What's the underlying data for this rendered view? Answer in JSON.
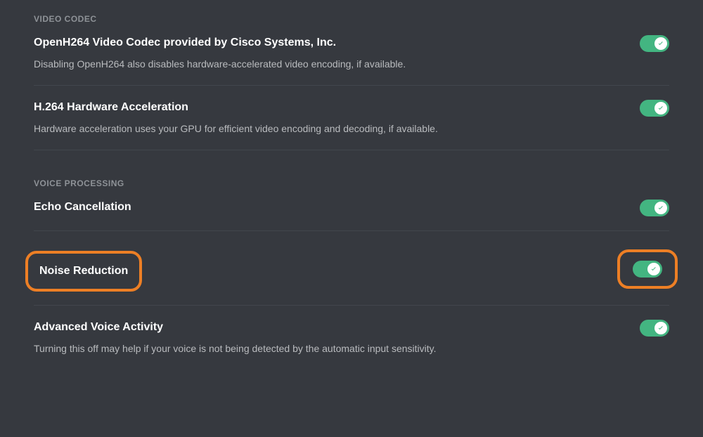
{
  "sections": {
    "videoCodec": {
      "header": "VIDEO CODEC",
      "items": [
        {
          "title": "OpenH264 Video Codec provided by Cisco Systems, Inc.",
          "desc": "Disabling OpenH264 also disables hardware-accelerated video encoding, if available.",
          "enabled": true
        },
        {
          "title": "H.264 Hardware Acceleration",
          "desc": "Hardware acceleration uses your GPU for efficient video encoding and decoding, if available.",
          "enabled": true
        }
      ]
    },
    "voiceProcessing": {
      "header": "VOICE PROCESSING",
      "items": [
        {
          "title": "Echo Cancellation",
          "enabled": true
        },
        {
          "title": "Noise Reduction",
          "enabled": true,
          "highlighted": true
        },
        {
          "title": "Advanced Voice Activity",
          "desc": "Turning this off may help if your voice is not being detected by the automatic input sensitivity.",
          "enabled": true
        }
      ]
    }
  },
  "colors": {
    "accentGreen": "#43b581",
    "highlightOrange": "#ed7f25",
    "background": "#36393f"
  }
}
